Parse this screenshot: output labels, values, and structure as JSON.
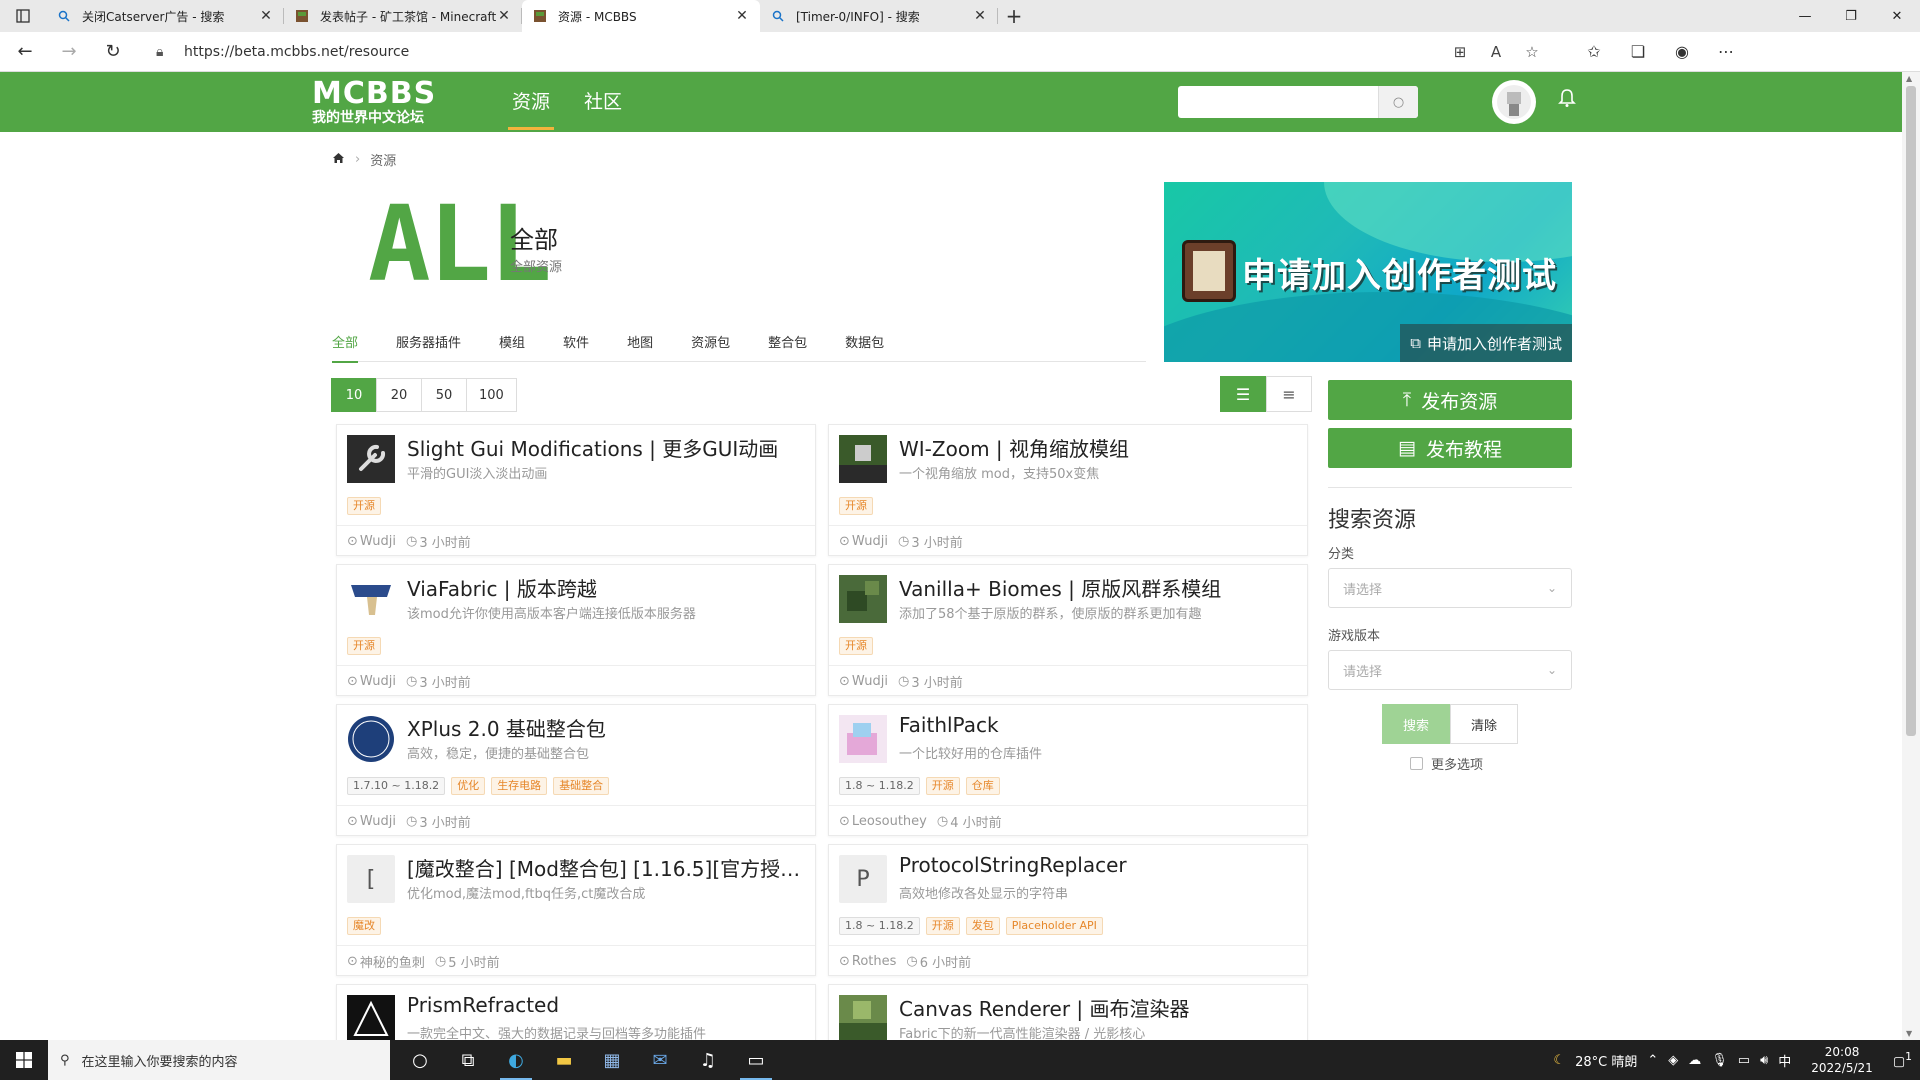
{
  "browser": {
    "tabs": [
      {
        "title": "关闭Catserver广告 - 搜索",
        "icon": "search-icon",
        "active": false
      },
      {
        "title": "发表帖子 - 矿工茶馆 - Minecraft",
        "icon": "mcbbs-favicon",
        "active": false
      },
      {
        "title": "资源 - MCBBS",
        "icon": "mcbbs-favicon",
        "active": true
      },
      {
        "title": "[Timer-0/INFO] - 搜索",
        "icon": "search-icon",
        "active": false
      }
    ],
    "url": "https://beta.mcbbs.net/resource"
  },
  "site": {
    "logo_top": "MCBBS",
    "logo_sub": "我的世界中文论坛",
    "nav": [
      {
        "label": "资源",
        "active": true
      },
      {
        "label": "社区",
        "active": false
      }
    ],
    "search_placeholder": ""
  },
  "breadcrumb": {
    "current": "资源"
  },
  "hero": {
    "big": "ALL",
    "title": "全部",
    "subtitle": "全部资源",
    "banner_text": "申请加入创作者测试",
    "banner_link": "申请加入创作者测试"
  },
  "categories": [
    {
      "label": "全部",
      "active": true
    },
    {
      "label": "服务器插件",
      "active": false
    },
    {
      "label": "模组",
      "active": false
    },
    {
      "label": "软件",
      "active": false
    },
    {
      "label": "地图",
      "active": false
    },
    {
      "label": "资源包",
      "active": false
    },
    {
      "label": "整合包",
      "active": false
    },
    {
      "label": "数据包",
      "active": false
    }
  ],
  "page_sizes": [
    {
      "label": "10",
      "active": true
    },
    {
      "label": "20",
      "active": false
    },
    {
      "label": "50",
      "active": false
    },
    {
      "label": "100",
      "active": false
    }
  ],
  "resources": [
    {
      "title": "Slight Gui Modifications | 更多GUI动画",
      "desc": "平滑的GUI淡入淡出动画",
      "tags": [
        "开源"
      ],
      "versions": [],
      "author": "Wudji",
      "time": "3 小时前",
      "icon": "wrench-icon"
    },
    {
      "title": "WI-Zoom | 视角缩放模组",
      "desc": "一个视角缩放 mod，支持50x变焦",
      "tags": [
        "开源"
      ],
      "versions": [],
      "author": "Wudji",
      "time": "3 小时前",
      "icon": "wizoom-image"
    },
    {
      "title": "ViaFabric | 版本跨越",
      "desc": "该mod允许你使用高版本客户端连接低版本服务器",
      "tags": [
        "开源"
      ],
      "versions": [],
      "author": "Wudji",
      "time": "3 小时前",
      "icon": "via-logo"
    },
    {
      "title": "Vanilla+ Biomes | 原版风群系模组",
      "desc": "添加了58个基于原版的群系，使原版的群系更加有趣",
      "tags": [
        "开源"
      ],
      "versions": [],
      "author": "Wudji",
      "time": "3 小时前",
      "icon": "biome-image"
    },
    {
      "title": "XPlus 2.0 基础整合包",
      "desc": "高效，稳定，便捷的基础整合包",
      "tags": [
        "优化",
        "生存电路",
        "基础整合"
      ],
      "versions": [
        "1.7.10 ~ 1.18.2"
      ],
      "author": "Wudji",
      "time": "3 小时前",
      "icon": "xplus-logo"
    },
    {
      "title": "FaithlPack",
      "desc": "一个比较好用的仓库插件",
      "tags": [
        "开源",
        "仓库"
      ],
      "versions": [
        "1.8 ~ 1.18.2"
      ],
      "author": "Leosouthey",
      "time": "4 小时前",
      "icon": "faithlpack-image"
    },
    {
      "title": "[魔改整合] [Mod整合包] [1.16.5][官方授权][...",
      "desc": "优化mod,魔法mod,ftbq任务,ct魔改合成",
      "tags": [
        "魔改"
      ],
      "versions": [],
      "author": "神秘的鱼刺",
      "time": "5 小时前",
      "icon": "letter-bracket",
      "letter": "["
    },
    {
      "title": "ProtocolStringReplacer",
      "desc": "高效地修改各处显示的字符串",
      "tags": [
        "开源",
        "发包",
        "Placeholder API"
      ],
      "versions": [
        "1.8 ~ 1.18.2"
      ],
      "author": "Rothes",
      "time": "6 小时前",
      "icon": "letter-p",
      "letter": "P"
    },
    {
      "title": "PrismRefracted",
      "desc": "一款完全中文、强大的数据记录与回档等多功能插件",
      "tags": [],
      "versions": [],
      "author": "",
      "time": "",
      "icon": "prism-image"
    },
    {
      "title": "Canvas Renderer | 画布渲染器",
      "desc": "Fabric下的新一代高性能渲染器 / 光影核心",
      "tags": [],
      "versions": [],
      "author": "",
      "time": "",
      "icon": "canvas-image"
    }
  ],
  "sidebar": {
    "publish_resource": "发布资源",
    "publish_tutorial": "发布教程",
    "search_title": "搜索资源",
    "category_label": "分类",
    "category_placeholder": "请选择",
    "version_label": "游戏版本",
    "version_placeholder": "请选择",
    "search_button": "搜索",
    "clear_button": "清除",
    "more_options": "更多选项"
  },
  "taskbar": {
    "search_placeholder": "在这里输入你要搜索的内容",
    "weather": "28°C 晴朗",
    "ime": "中",
    "time": "20:08",
    "date": "2022/5/21",
    "notifications": "1"
  },
  "colors": {
    "brand": "#52a645",
    "tag_orange": "#e6872a",
    "accent_underline": "#f3b33d"
  }
}
